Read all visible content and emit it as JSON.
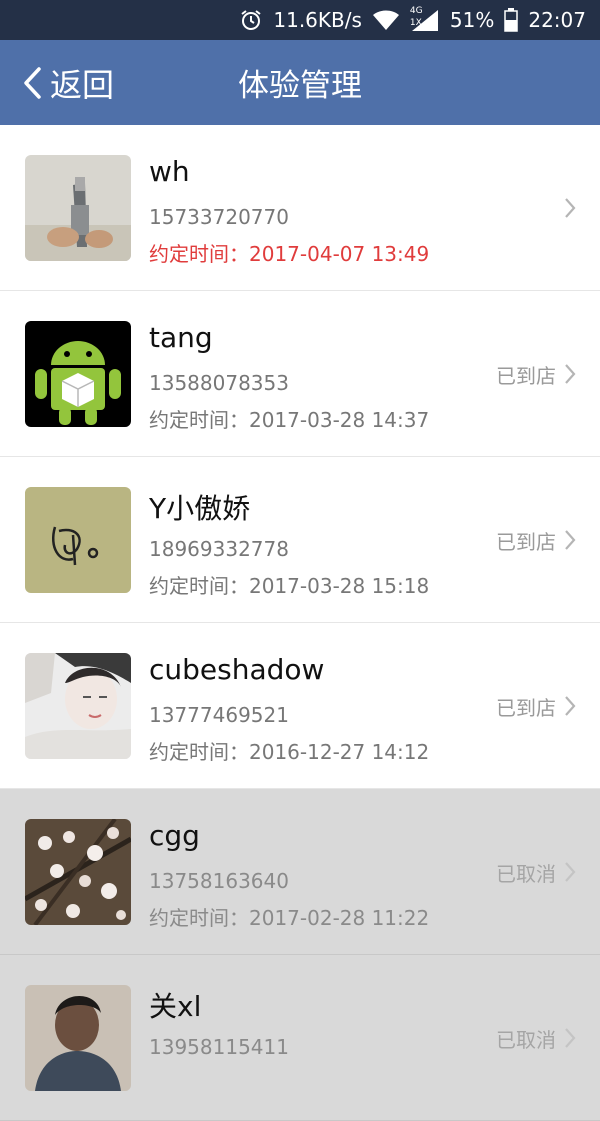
{
  "status_bar": {
    "speed": "11.6KB/s",
    "network": "4G",
    "network_sub": "1X",
    "battery": "51%",
    "time": "22:07"
  },
  "nav": {
    "back_label": "返回",
    "title": "体验管理"
  },
  "appointments": [
    {
      "name": "wh",
      "phone": "15733720770",
      "time_label": "约定时间：2017-04-07 13:49",
      "status": ""
    },
    {
      "name": "tang",
      "phone": "13588078353",
      "time_label": "约定时间：2017-03-28 14:37",
      "status": "已到店"
    },
    {
      "name": "Y小傲娇",
      "phone": "18969332778",
      "time_label": "约定时间：2017-03-28 15:18",
      "status": "已到店"
    },
    {
      "name": "cubeshadow",
      "phone": "13777469521",
      "time_label": "约定时间：2016-12-27 14:12",
      "status": "已到店"
    },
    {
      "name": "cgg",
      "phone": "13758163640",
      "time_label": "约定时间：2017-02-28 11:22",
      "status": "已取消"
    },
    {
      "name": "关xl",
      "phone": "13958115411",
      "time_label": "",
      "status": "已取消"
    }
  ]
}
